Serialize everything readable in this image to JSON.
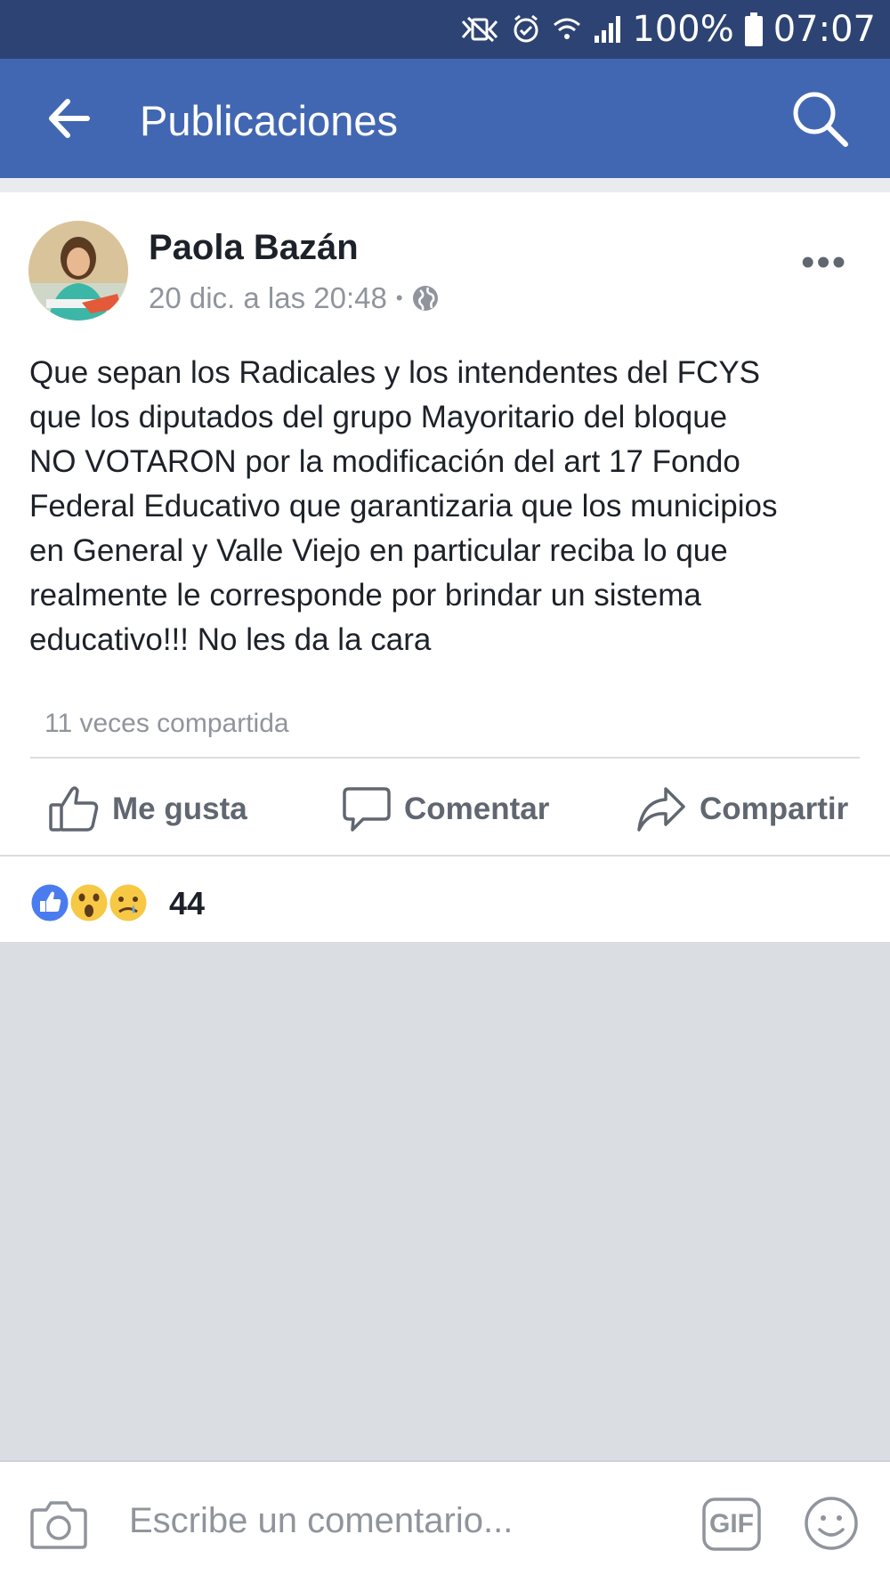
{
  "status_bar": {
    "battery": "100%",
    "time": "07:07",
    "icons": [
      "mute-vibrate-icon",
      "alarm-icon",
      "wifi-icon",
      "signal-icon",
      "battery-icon"
    ]
  },
  "header": {
    "title": "Publicaciones",
    "back_icon": "back-arrow-icon",
    "search_icon": "search-icon",
    "color": "#4267b2"
  },
  "post": {
    "author": "Paola Bazán",
    "timestamp": "20 dic. a las 20:48",
    "separator": "•",
    "privacy_icon": "globe-icon",
    "more": "•••",
    "text_lines": [
      "Que sepan los Radicales y los intendentes del FCYS",
      "que los diputados del grupo Mayoritario del bloque",
      "NO VOTARON por la modificación del art 17 Fondo",
      "Federal Educativo que garantizaria que los municipios",
      "en General y Valle Viejo en particular reciba lo que",
      "realmente le corresponde por brindar un sistema",
      "educativo!!! No les da la cara"
    ],
    "shares": "11 veces compartida"
  },
  "actions": {
    "like": "Me gusta",
    "comment": "Comentar",
    "share": "Compartir"
  },
  "reactions": {
    "icons": [
      "like-reaction-icon",
      "wow-reaction-icon",
      "sad-reaction-icon"
    ],
    "count": "44"
  },
  "composer": {
    "placeholder": "Escribe un comentario...",
    "gif_label": "GIF"
  }
}
